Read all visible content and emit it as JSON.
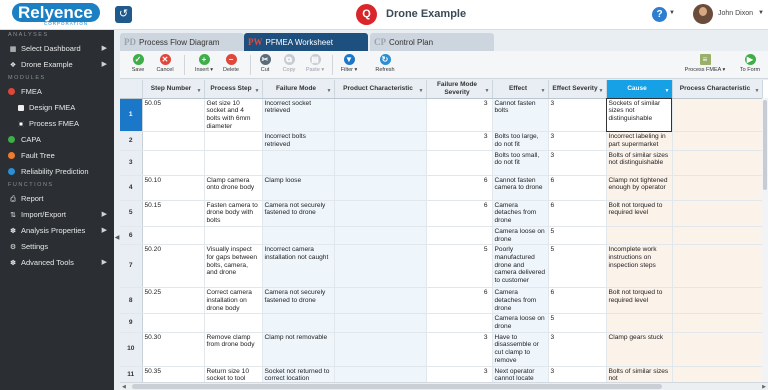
{
  "header": {
    "logo_text": "Relyence",
    "logo_sub": "CORPORATION",
    "app_title": "Drone Example",
    "user_name": "John Dixon"
  },
  "sidebar": {
    "section_analyses": "ANALYSES",
    "section_modules": "MODULES",
    "section_functions": "FUNCTIONS",
    "analyses": [
      {
        "label": "Select Dashboard",
        "icon": "dashboard-icon"
      },
      {
        "label": "Drone Example",
        "icon": "drone-icon"
      }
    ],
    "modules": [
      {
        "label": "FMEA",
        "color": "#e0473a"
      },
      {
        "label": "Design FMEA",
        "sub": true
      },
      {
        "label": "Process FMEA",
        "sub": true,
        "checked": true
      },
      {
        "label": "CAPA",
        "color": "#3fae49"
      },
      {
        "label": "Fault Tree",
        "color": "#f07a2d"
      },
      {
        "label": "Reliability Prediction",
        "color": "#2a8fd6"
      }
    ],
    "functions": [
      {
        "label": "Report",
        "icon": "print-icon"
      },
      {
        "label": "Import/Export",
        "icon": "import-export-icon"
      },
      {
        "label": "Analysis Properties",
        "icon": "wrench-icon"
      },
      {
        "label": "Settings",
        "icon": "gear-icon"
      },
      {
        "label": "Advanced Tools",
        "icon": "tools-icon"
      }
    ]
  },
  "tabs": [
    {
      "abbr": "PD",
      "label": "Process Flow Diagram"
    },
    {
      "abbr": "PW",
      "label": "PFMEA Worksheet",
      "active": true
    },
    {
      "abbr": "CP",
      "label": "Control Plan"
    }
  ],
  "toolbar": {
    "save": "Save",
    "cancel": "Cancel",
    "insert": "Insert ▾",
    "delete": "Delete",
    "cut": "Cut",
    "copy": "Copy",
    "paste": "Paste ▾",
    "filter": "Filter ▾",
    "refresh": "Refresh",
    "process_fmea": "Process FMEA ▾",
    "to_form": "To Form"
  },
  "grid": {
    "columns": [
      "Step Number",
      "Process Step",
      "Failure Mode",
      "Product Characteristic",
      "Failure Mode Severity",
      "Effect",
      "Effect Severity",
      "Cause",
      "Process Characteristic"
    ],
    "rows": [
      {
        "n": "1",
        "step": "50.05",
        "pstep": "Get size 10 socket and 4 bolts with 6mm diameter",
        "fm": "Incorrect socket retrieved",
        "pc": "",
        "fms": "3",
        "eff": "Cannot fasten bolts",
        "es": "3",
        "cause": "Sockets of similar sizes not distinguishable",
        "proc": ""
      },
      {
        "n": "2",
        "step": "",
        "pstep": "",
        "fm": "Incorrect bolts retrieved",
        "pc": "",
        "fms": "3",
        "eff": "Bolts too large, do not fit",
        "es": "3",
        "cause": "Incorrect labeling in part supermarket",
        "proc": ""
      },
      {
        "n": "3",
        "step": "",
        "pstep": "",
        "fm": "",
        "pc": "",
        "fms": "",
        "eff": "Bolts too small, do not fit",
        "es": "3",
        "cause": "Bolts of similar sizes not distinguishable",
        "proc": ""
      },
      {
        "n": "4",
        "step": "50.10",
        "pstep": "Clamp camera onto drone body",
        "fm": "Clamp loose",
        "pc": "",
        "fms": "6",
        "eff": "Cannot fasten camera to drone",
        "es": "6",
        "cause": "Clamp not tightened enough by operator",
        "proc": ""
      },
      {
        "n": "5",
        "step": "50.15",
        "pstep": "Fasten camera to drone body with bolts",
        "fm": "Camera not securely fastened to drone",
        "pc": "",
        "fms": "6",
        "eff": "Camera detaches from drone",
        "es": "6",
        "cause": "Bolt not torqued to required level",
        "proc": ""
      },
      {
        "n": "6",
        "step": "",
        "pstep": "",
        "fm": "",
        "pc": "",
        "fms": "",
        "eff": "Camera loose on drone",
        "es": "5",
        "cause": "",
        "proc": ""
      },
      {
        "n": "7",
        "step": "50.20",
        "pstep": "Visually inspect for gaps between bolts, camera, and drone",
        "fm": "Incorrect camera installation not caught",
        "pc": "",
        "fms": "5",
        "eff": "Poorly manufactured drone and camera delivered to customer",
        "es": "5",
        "cause": "Incomplete work instructions on inspection steps",
        "proc": ""
      },
      {
        "n": "8",
        "step": "50.25",
        "pstep": "Correct camera installation on drone body",
        "fm": "Camera not securely fastened to drone",
        "pc": "",
        "fms": "6",
        "eff": "Camera detaches from drone",
        "es": "6",
        "cause": "Bolt not torqued to required level",
        "proc": ""
      },
      {
        "n": "9",
        "step": "",
        "pstep": "",
        "fm": "",
        "pc": "",
        "fms": "",
        "eff": "Camera loose on drone",
        "es": "5",
        "cause": "",
        "proc": ""
      },
      {
        "n": "10",
        "step": "50.30",
        "pstep": "Remove clamp from drone body",
        "fm": "Clamp not removable",
        "pc": "",
        "fms": "3",
        "eff": "Have to disassemble or cut clamp to remove",
        "es": "3",
        "cause": "Clamp gears stuck",
        "proc": ""
      },
      {
        "n": "11",
        "step": "50.35",
        "pstep": "Return size 10 socket to tool",
        "fm": "Socket not returned to correct location",
        "pc": "",
        "fms": "3",
        "eff": "Next operator cannot locate",
        "es": "3",
        "cause": "Bolts of similar sizes not",
        "proc": ""
      }
    ]
  },
  "colors": {
    "accent": "#1b78c8",
    "selected_header": "#16a0e5",
    "brand": "#1b7fc4",
    "app_red": "#d8262a"
  }
}
